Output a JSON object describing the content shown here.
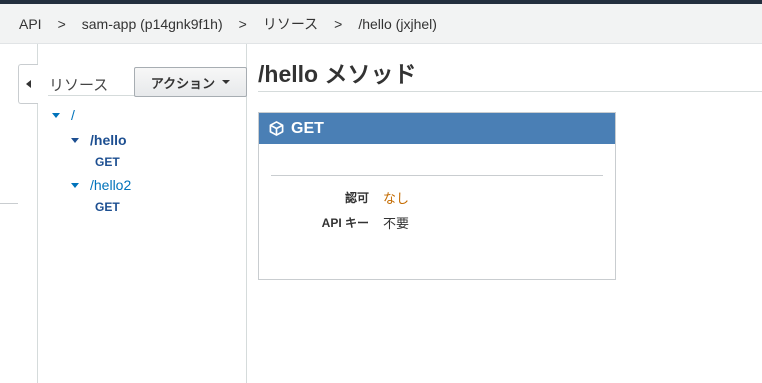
{
  "breadcrumb": {
    "items": [
      "API",
      "sam-app (p14gnk9f1h)",
      "リソース",
      "/hello (jxjhel)"
    ],
    "separator": ">"
  },
  "resources": {
    "title": "リソース",
    "actions_label": "アクション",
    "tree": {
      "root": {
        "path": "/"
      },
      "hello": {
        "path": "/hello",
        "method": "GET",
        "selected": true
      },
      "hello2": {
        "path": "/hello2",
        "method": "GET"
      }
    }
  },
  "main": {
    "title": "/hello メソッド",
    "method_box": {
      "method": "GET",
      "rows": [
        {
          "label": "認可",
          "value": "なし"
        },
        {
          "label": "API キー",
          "value": "不要"
        }
      ]
    }
  },
  "colors": {
    "accent_header": "#4a7fb5",
    "link_blue": "#0073bb",
    "link_orange": "#c46b00",
    "top_bar": "#232f3e"
  },
  "icons": {
    "collapse": "caret-left-icon",
    "method": "cube-icon",
    "tree_expand": "caret-down-icon"
  }
}
